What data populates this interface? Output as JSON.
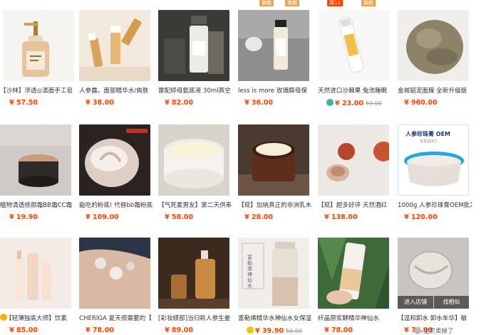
{
  "top_tags": {
    "c4_tag1": "旗舰",
    "c4_tag2": "旗舰",
    "c5_tag1": "双11",
    "c5_tag2": "旗舰"
  },
  "rows": [
    [
      {
        "title": "【沙林】滲透◎清面手工皂",
        "price": "¥ 57.50"
      },
      {
        "title": "人参露。面部精华水/爽肤",
        "price": "¥ 38.00"
      },
      {
        "title": "雷配婷母氨底液 30ml真空",
        "price": "¥ 82.00"
      },
      {
        "title": "less is more 玫瑰醇母保",
        "price": "¥ 36.00"
      },
      {
        "title": "天然进口沙棘果 兔洗睡眠",
        "price": "¥ 23.00",
        "old_price": "59.00"
      },
      {
        "title": "金城貂泥面膜 全新升级版",
        "price": "¥ 960.00"
      }
    ],
    [
      {
        "title": "植物清透修颜霜BB霜CC霜",
        "price": "¥ 19.90"
      },
      {
        "title": "能吃的粉底! 代替bb霜粉底",
        "price": "¥ 109.00"
      },
      {
        "title": "【气死素男友】第二天供奉",
        "price": "¥ 58.00"
      },
      {
        "title": "【现】加纳真正的非洲乳木",
        "price": "¥ 28.00"
      },
      {
        "title": "【现】超多好评 天然酒红",
        "price": "¥ 138.00"
      },
      {
        "title": "1000g 人参珍珠膏OEM批发",
        "price": "¥ 120.00"
      }
    ],
    [
      {
        "title": "【轻薄独底大师】饮素",
        "price": "¥ 85.00"
      },
      {
        "title": "CHERIGA 夏天很需要的【",
        "price": "¥ 78.00"
      },
      {
        "title": "[彩妆顺部]当归新人参生姜",
        "price": "¥ 89.00"
      },
      {
        "title": "富勒烯精华水神仙水女保湿",
        "price": "¥ 39.90",
        "old_price": "56.00"
      },
      {
        "title": "纤晶原浆酵精华神仙水",
        "price": "¥ 78.00"
      },
      {
        "title": "【温和卸水 卸水年华】敏",
        "price": "¥ 78.00"
      }
    ]
  ],
  "overlay": {
    "enter_shop": "进入店铺",
    "find_similar": "找相似"
  },
  "product_labels": {
    "oem_heading": "人参珍珠膏 OEM",
    "oem_sub": "化妆品加工",
    "bottle_text": "富勒烯神仙水"
  },
  "seller_note": "宝贝卖掉了"
}
